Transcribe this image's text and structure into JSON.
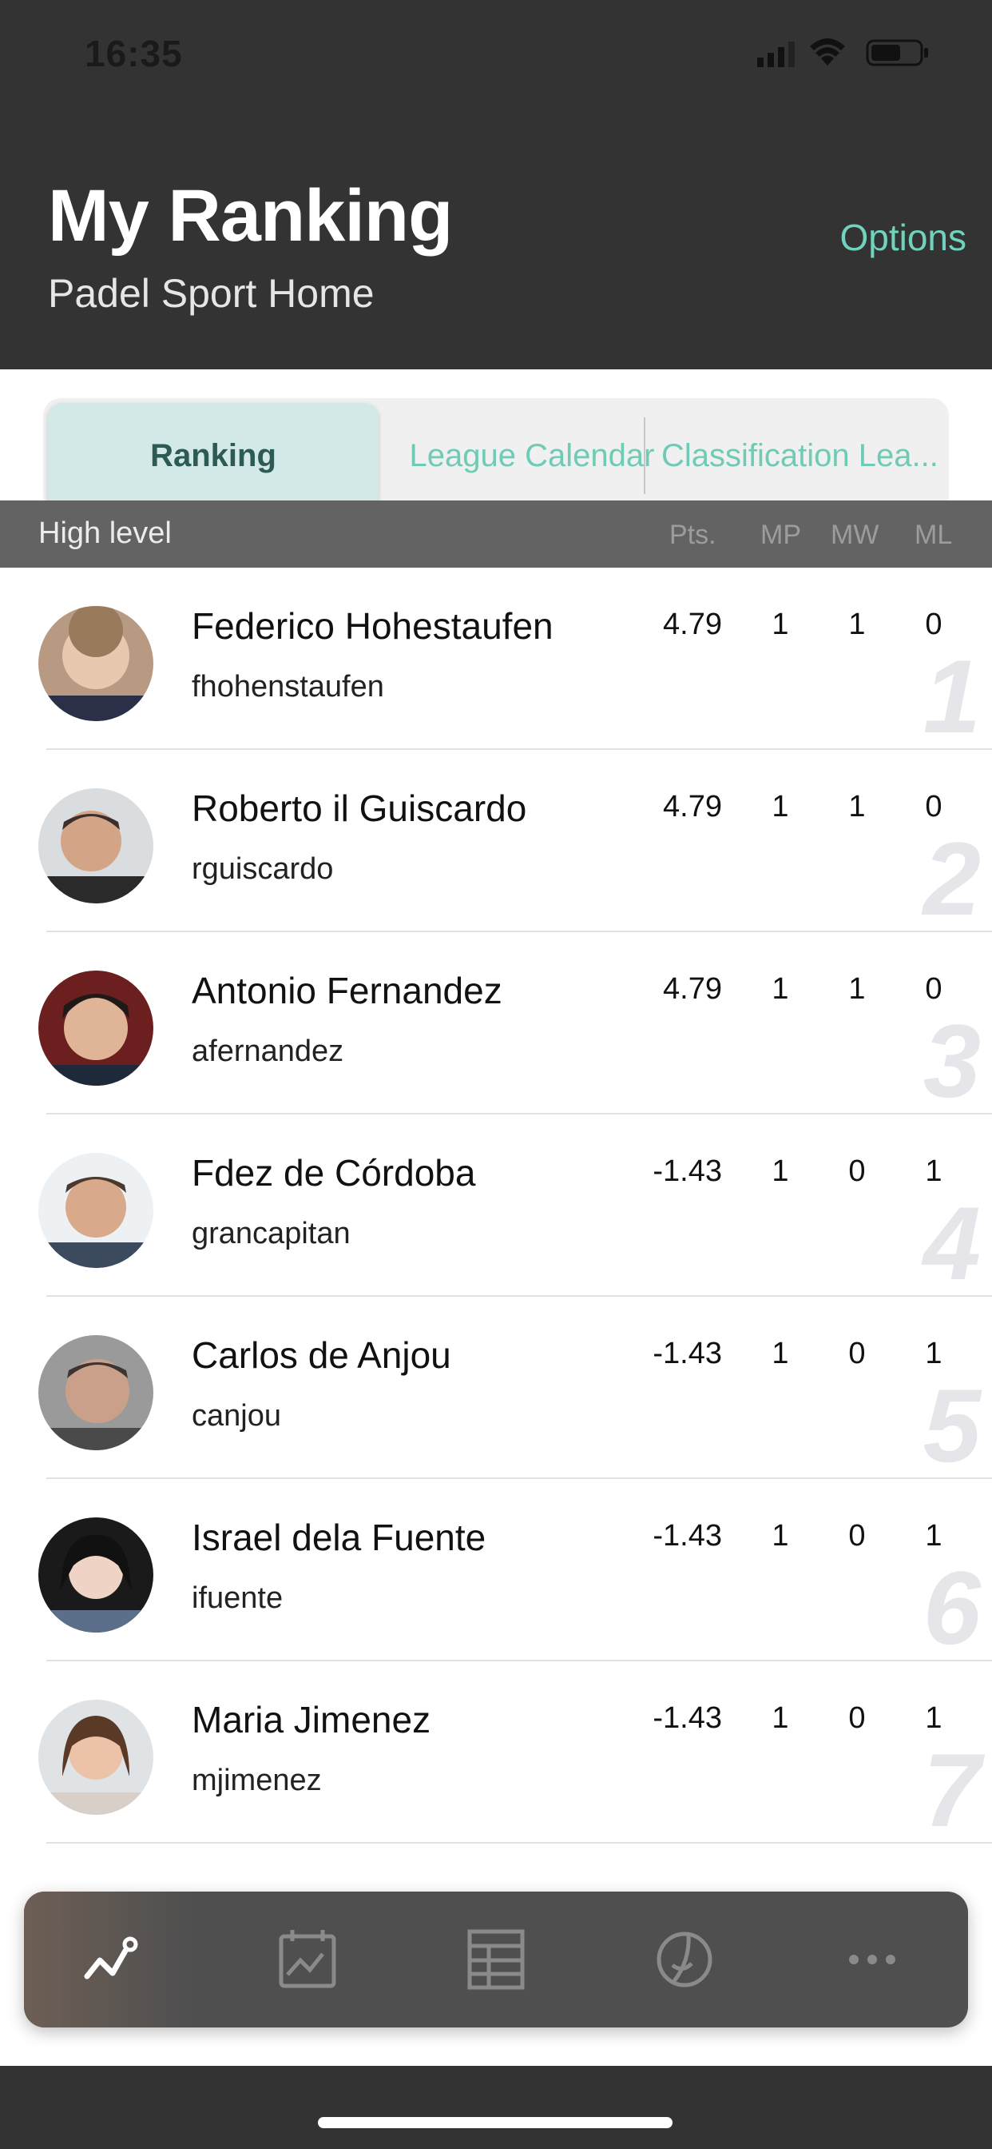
{
  "status_bar": {
    "time": "16:35"
  },
  "header": {
    "title": "My Ranking",
    "subtitle": "Padel Sport Home",
    "options_label": "Options"
  },
  "tabs": [
    {
      "label": "Ranking",
      "selected": true
    },
    {
      "label": "League Calendar",
      "selected": false
    },
    {
      "label": "Classification Lea...",
      "selected": false
    }
  ],
  "table": {
    "level_label": "High level",
    "columns": [
      "Pts.",
      "MP",
      "MW",
      "ML"
    ]
  },
  "players": [
    {
      "name": "Federico Hohestaufen",
      "username": "fhohenstaufen",
      "pts": "4.79",
      "mp": "1",
      "mw": "1",
      "ml": "0",
      "rank": "1"
    },
    {
      "name": "Roberto il Guiscardo",
      "username": "rguiscardo",
      "pts": "4.79",
      "mp": "1",
      "mw": "1",
      "ml": "0",
      "rank": "2"
    },
    {
      "name": "Antonio Fernandez",
      "username": "afernandez",
      "pts": "4.79",
      "mp": "1",
      "mw": "1",
      "ml": "0",
      "rank": "3"
    },
    {
      "name": "Fdez de Córdoba",
      "username": "grancapitan",
      "pts": "-1.43",
      "mp": "1",
      "mw": "0",
      "ml": "1",
      "rank": "4"
    },
    {
      "name": "Carlos de Anjou",
      "username": "canjou",
      "pts": "-1.43",
      "mp": "1",
      "mw": "0",
      "ml": "1",
      "rank": "5"
    },
    {
      "name": "Israel dela Fuente",
      "username": "ifuente",
      "pts": "-1.43",
      "mp": "1",
      "mw": "0",
      "ml": "1",
      "rank": "6"
    },
    {
      "name": "Maria Jimenez",
      "username": "mjimenez",
      "pts": "-1.43",
      "mp": "1",
      "mw": "0",
      "ml": "1",
      "rank": "7"
    }
  ],
  "tab_bar": {
    "items": [
      "ranking-trend-icon",
      "calendar-chart-icon",
      "table-icon",
      "padel-ball-icon",
      "more-icon"
    ],
    "active": 0
  },
  "colors": {
    "header_bg": "#333333",
    "accent": "#6fd3bd",
    "table_header_bg": "#636363",
    "tab_bar_bg": "#4f4f4f"
  }
}
